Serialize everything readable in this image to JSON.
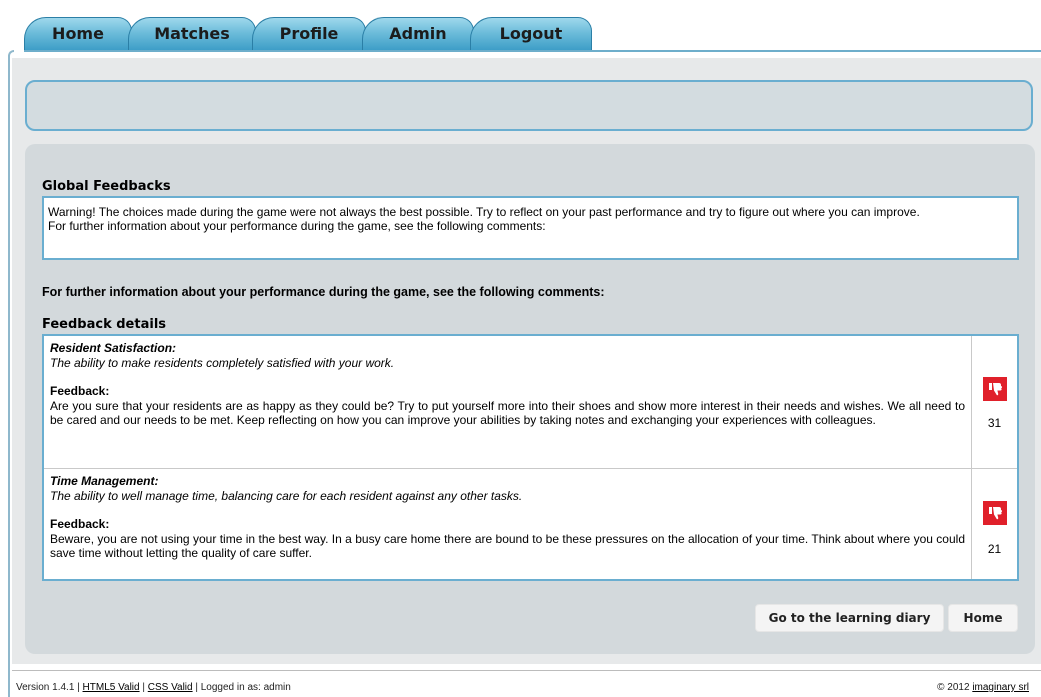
{
  "nav": {
    "tabs": [
      "Home",
      "Matches",
      "Profile",
      "Admin",
      "Logout"
    ]
  },
  "global_feedbacks": {
    "title": "Global Feedbacks",
    "line1": "Warning! The choices made during the game were not always the best possible. Try to reflect on your past performance and try to figure out where you can improve.",
    "line2": "For further information about your performance during the game, see the following comments:"
  },
  "further_info": "For further information about your performance during the game, see the following comments:",
  "feedback_details": {
    "title": "Feedback details",
    "items": [
      {
        "name": "Resident Satisfaction",
        "description": "The ability to make residents completely satisfied with your work.",
        "feedback_label": "Feedback:",
        "feedback_text": "Are you sure that your residents are as happy as they could be? Try to put yourself more into their shoes and show more interest in their needs and wishes. We all need to be cared and our needs to be met. Keep reflecting on how you can improve your abilities by taking notes and exchanging your experiences with colleagues.",
        "score": "31",
        "icon": "thumbs-down-icon"
      },
      {
        "name": "Time Management",
        "description": "The ability to well manage time, balancing care for each resident against any other tasks.",
        "feedback_label": "Feedback:",
        "feedback_text": "Beware, you are not using your time in the best way. In a busy care home there are bound to be these pressures on the allocation of your time. Think about where you could save time without letting the quality of care suffer.",
        "score": "21",
        "icon": "thumbs-down-icon"
      }
    ]
  },
  "buttons": {
    "learning_diary": "Go to the learning diary",
    "home": "Home"
  },
  "footer": {
    "version": "Version 1.4.1 | ",
    "html5": "HTML5 Valid",
    "sep1": " | ",
    "css": "CSS Valid",
    "logged": " | Logged in as: admin",
    "copyright": "© 2012 ",
    "company": "imaginary srl"
  },
  "colors": {
    "tab_blue": "#6cbcda",
    "border_blue": "#6aaed0",
    "thumb_red": "#e0202a"
  }
}
